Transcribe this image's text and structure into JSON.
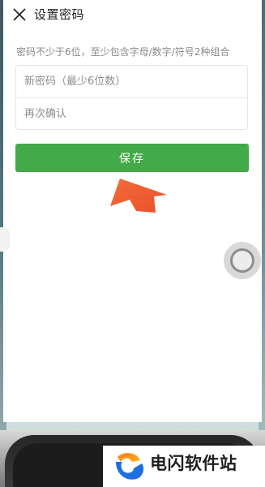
{
  "header": {
    "title": "设置密码",
    "close_icon": "close-icon"
  },
  "form": {
    "hint": "密码不少于6位，至少包含字母/数字/符号2种组合",
    "new_password_placeholder": "新密码（最少6位数）",
    "confirm_placeholder": "再次确认",
    "save_label": "保存"
  },
  "overlay": {
    "arrow_icon": "arrow-up-icon",
    "float_button_icon": "assistive-touch-icon"
  },
  "watermark": {
    "text": "电闪软件站",
    "logo_icon": "watermark-logo-icon"
  },
  "colors": {
    "accent_green": "#44a948",
    "arrow_orange": "#f25a2a"
  }
}
